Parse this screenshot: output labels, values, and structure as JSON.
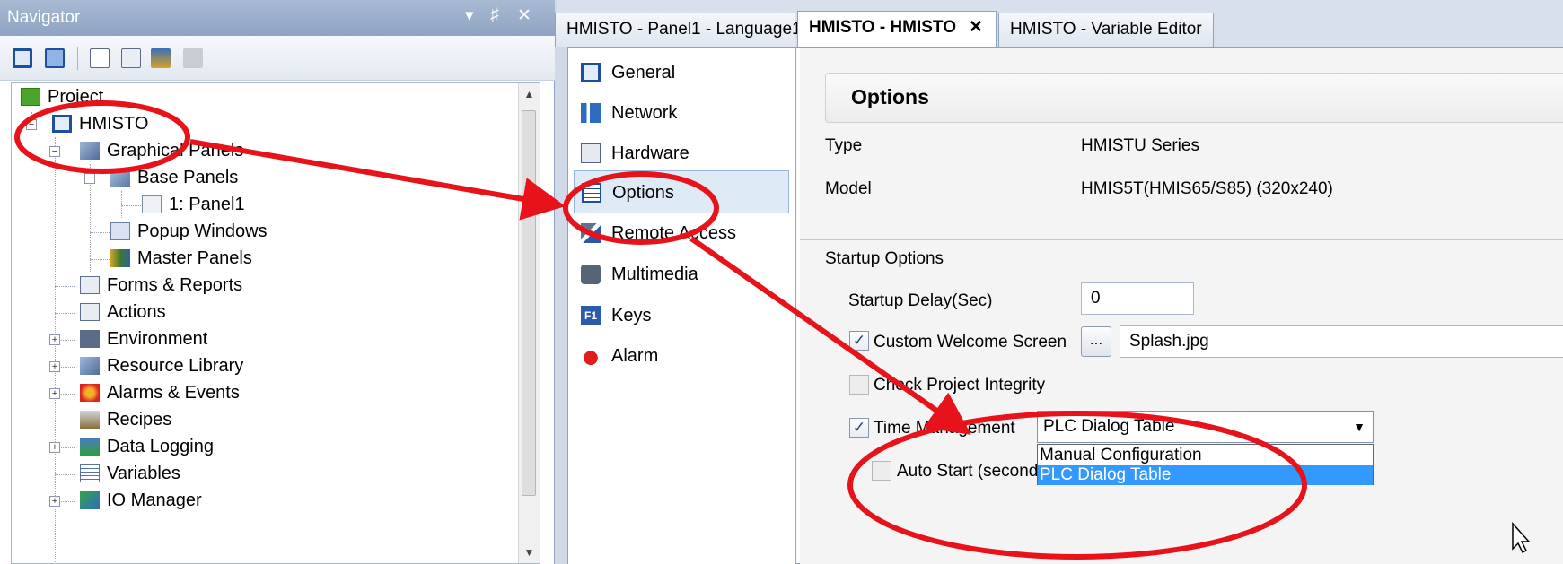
{
  "navigator": {
    "title": "Navigator",
    "controls": [
      "▾",
      "♯",
      "✕"
    ],
    "tree": [
      {
        "label": "Project",
        "icon": "project-icon"
      },
      {
        "label": "HMISTO",
        "icon": "panel-device-icon"
      },
      {
        "label": "Graphical Panels",
        "icon": "graphical-panels-icon"
      },
      {
        "label": "Base Panels",
        "icon": "base-panels-icon"
      },
      {
        "label": "1: Panel1",
        "icon": "panel-page-icon"
      },
      {
        "label": "Popup Windows",
        "icon": "popup-windows-icon"
      },
      {
        "label": "Master Panels",
        "icon": "master-panels-icon"
      },
      {
        "label": "Forms & Reports",
        "icon": "forms-reports-icon"
      },
      {
        "label": "Actions",
        "icon": "actions-icon"
      },
      {
        "label": "Environment",
        "icon": "environment-icon"
      },
      {
        "label": "Resource Library",
        "icon": "resource-library-icon"
      },
      {
        "label": "Alarms & Events",
        "icon": "alarms-events-icon"
      },
      {
        "label": "Recipes",
        "icon": "recipes-icon"
      },
      {
        "label": "Data Logging",
        "icon": "data-logging-icon"
      },
      {
        "label": "Variables",
        "icon": "variables-icon"
      },
      {
        "label": "IO Manager",
        "icon": "io-manager-icon"
      }
    ]
  },
  "tabs": [
    {
      "label": "HMISTO - Panel1 - Language1"
    },
    {
      "label": "HMISTO - HMISTO",
      "close": "✕"
    },
    {
      "label": "HMISTO - Variable Editor"
    }
  ],
  "menu": [
    {
      "label": "General",
      "icon": "general-icon"
    },
    {
      "label": "Network",
      "icon": "network-icon"
    },
    {
      "label": "Hardware",
      "icon": "hardware-icon"
    },
    {
      "label": "Options",
      "icon": "options-icon"
    },
    {
      "label": "Remote Access",
      "icon": "remote-access-icon"
    },
    {
      "label": "Multimedia",
      "icon": "multimedia-icon"
    },
    {
      "label": "Keys",
      "icon": "keys-icon",
      "badge": "F1"
    },
    {
      "label": "Alarm",
      "icon": "alarm-icon"
    }
  ],
  "options": {
    "title": "Options",
    "type_label": "Type",
    "type_value": "HMISTU Series",
    "model_label": "Model",
    "model_value": "HMIS5T(HMIS65/S85) (320x240)",
    "startup_section": "Startup Options",
    "startup_delay_label": "Startup Delay(Sec)",
    "startup_delay_value": "0",
    "welcome_label": "Custom Welcome Screen",
    "welcome_checked": "✓",
    "browse_label": "...",
    "welcome_file": "Splash.jpg",
    "integrity_label": "Check Project Integrity",
    "time_label": "Time Management",
    "time_checked": "✓",
    "time_value": "PLC Dialog Table",
    "time_caret": "▼",
    "time_options": [
      "Manual Configuration",
      "PLC Dialog Table"
    ],
    "autostart_label": "Auto Start (seconds)"
  },
  "colors": {
    "annotation": "#e8121a",
    "selection": "#3399ff"
  }
}
